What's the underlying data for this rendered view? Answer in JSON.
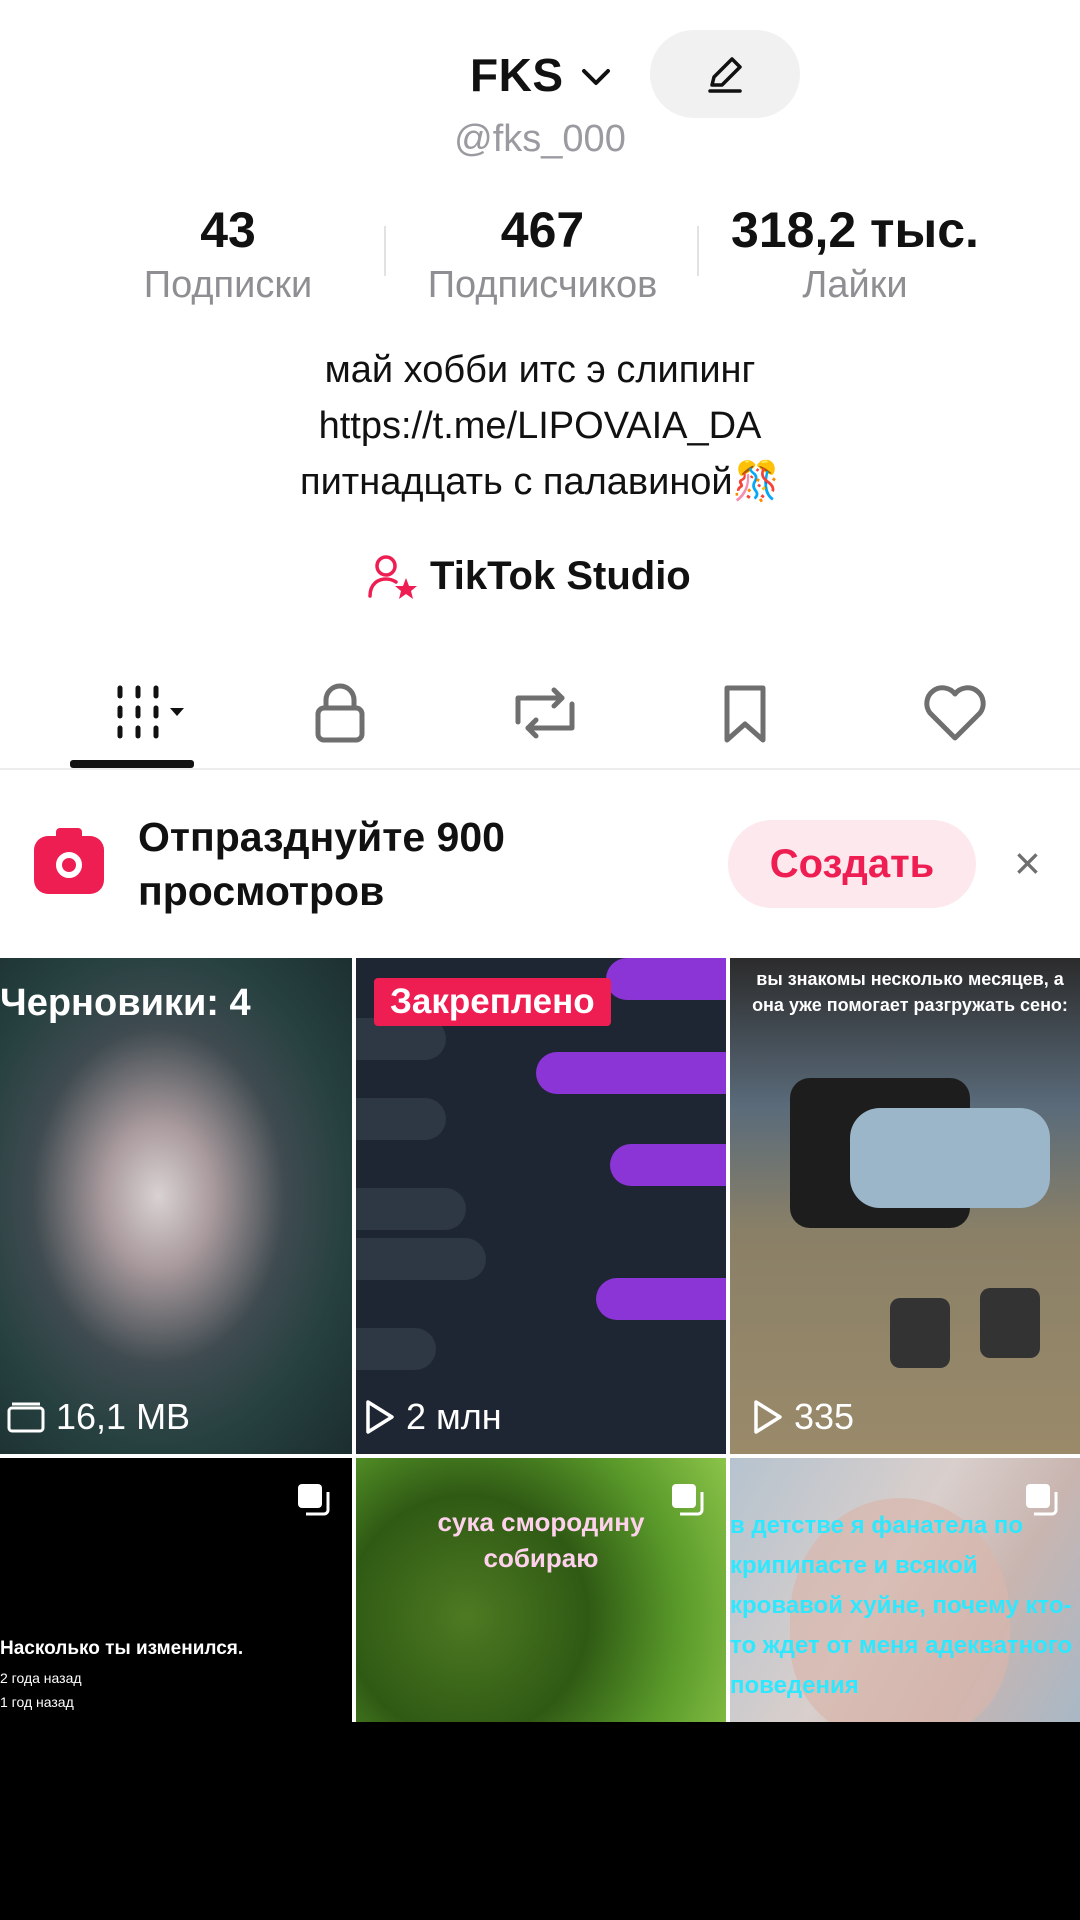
{
  "profile": {
    "username": "FKS",
    "handle": "@fks_000"
  },
  "stats": [
    {
      "value": "43",
      "label": "Подписки"
    },
    {
      "value": "467",
      "label": "Подписчиков"
    },
    {
      "value": "318,2 тыс.",
      "label": "Лайки"
    }
  ],
  "bio": {
    "line1": "май хобби итс э слипинг",
    "line2": "https://t.me/LIPOVAIA_DA",
    "line3": "питнадцать с палавиной🎊"
  },
  "studio": {
    "label": "TikTok Studio"
  },
  "tabs": [
    "videos-grid-icon",
    "lock-icon",
    "repost-icon",
    "bookmark-icon",
    "heart-icon"
  ],
  "banner": {
    "line1": "Отпразднуйте 900",
    "line2": "просмотров",
    "create_label": "Создать",
    "close_label": "×"
  },
  "grid": [
    {
      "drafts_label": "Черновики: 4",
      "size": "16,1 MB"
    },
    {
      "pinned_label": "Закреплено",
      "views": "2 млн"
    },
    {
      "caption": "вы знакомы несколько месяцев, а она уже помогает разгружать сено:",
      "views": "335"
    },
    {
      "caption": "Насколько ты изменился.",
      "line2": "2 года назад",
      "line3": "1 год назад"
    },
    {
      "caption": "сука смородину собираю"
    },
    {
      "caption": "в детстве я фанатела по крипипасте и всякой кровавой хуйне, почему кто-то ждет от меня адекватного поведения"
    }
  ],
  "colors": {
    "accent": "#ee1d52",
    "pinned": "#ee1d52"
  }
}
